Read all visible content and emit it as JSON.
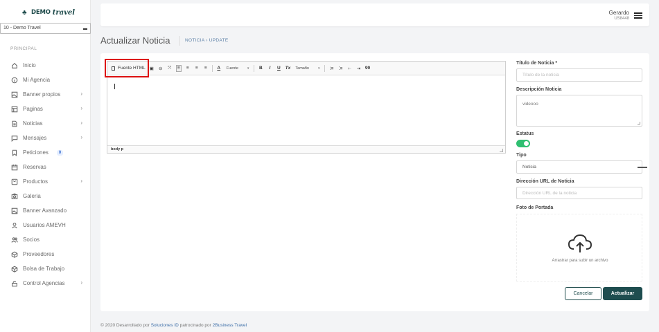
{
  "sidebar": {
    "logo_brand": "DEMO",
    "logo_brand2": "travel",
    "agency_select": "10 - Demo Travel",
    "section_title": "PRINCIPAL",
    "items": [
      {
        "label": "Inicio",
        "icon": "home-icon",
        "chevron": false
      },
      {
        "label": "Mi Agencia",
        "icon": "info-icon",
        "chevron": false
      },
      {
        "label": "Banner propios",
        "icon": "image-icon",
        "chevron": true
      },
      {
        "label": "Paginas",
        "icon": "layout-icon",
        "chevron": true
      },
      {
        "label": "Noticias",
        "icon": "document-icon",
        "chevron": true
      },
      {
        "label": "Mensajes",
        "icon": "message-icon",
        "chevron": true
      },
      {
        "label": "Peticiones",
        "icon": "bookmark-icon",
        "chevron": false,
        "badge": "0"
      },
      {
        "label": "Reservas",
        "icon": "calendar-icon",
        "chevron": false
      },
      {
        "label": "Productos",
        "icon": "box-icon",
        "chevron": true
      },
      {
        "label": "Galeria",
        "icon": "camera-icon",
        "chevron": false
      },
      {
        "label": "Banner Avanzado",
        "icon": "image-icon",
        "chevron": false
      },
      {
        "label": "Usuarios AMEVH",
        "icon": "user-icon",
        "chevron": false
      },
      {
        "label": "Socios",
        "icon": "users-icon",
        "chevron": false
      },
      {
        "label": "Proveedores",
        "icon": "package-icon",
        "chevron": false
      },
      {
        "label": "Bolsa de Trabajo",
        "icon": "package-icon",
        "chevron": false
      },
      {
        "label": "Control Agencias",
        "icon": "lock-icon",
        "chevron": true
      }
    ],
    "chevron_glyph": "›"
  },
  "topbar": {
    "user_name": "Gerardo",
    "user_id": "US8448"
  },
  "page": {
    "title": "Actualizar Noticia",
    "breadcrumb": "NOTICIA  ›  UPDATE"
  },
  "editor": {
    "source_label": "Fuente HTML",
    "font_label": "Fuente",
    "size_label": "Tamaño",
    "statusbar": "body  p",
    "buttons": {
      "bold": "B",
      "italic": "I",
      "underline": "U",
      "clear": "Tx",
      "quote": "99",
      "font_color": "A"
    }
  },
  "form": {
    "title_label": "Título de Noticia *",
    "title_placeholder": "Título de la noticia",
    "description_label": "Descripción Noticia",
    "description_value": "videooo",
    "status_label": "Estatus",
    "status_on": true,
    "type_label": "Tipo",
    "type_value": "Noticia",
    "url_label": "Dirección URL de Noticia",
    "url_placeholder": "Dirección URL de la noticia",
    "cover_label": "Foto de Portada",
    "upload_text": "Arrastrar para subir un archivo",
    "cancel_label": "Cancelar",
    "update_label": "Actualizar"
  },
  "footer": {
    "prefix": "© 2020 Desarrollado por ",
    "link1": "Soluciones ID",
    "middle": " patrocinado por ",
    "link2": "2Business Travel"
  },
  "colors": {
    "accent": "#1e4d4f",
    "toggle_on": "#2fbf71",
    "highlight": "#dd1111",
    "link": "#3c6ea8"
  }
}
